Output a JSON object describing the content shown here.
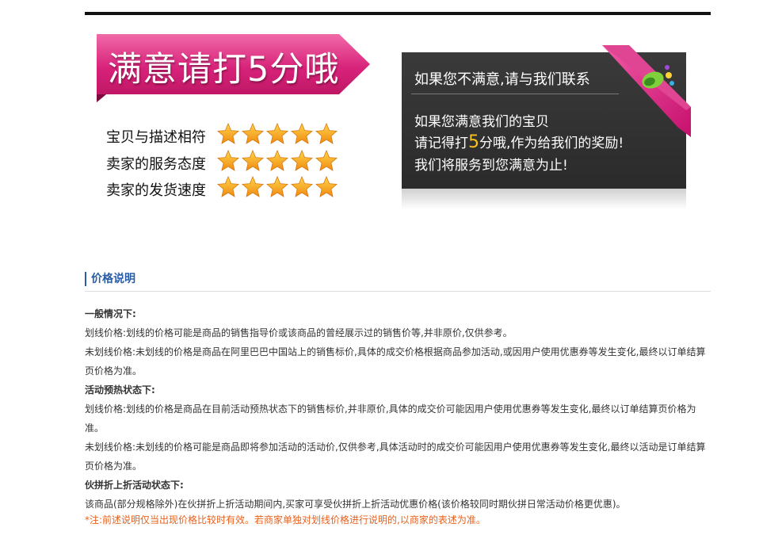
{
  "banner": {
    "title": "满意请打5分哦"
  },
  "ratings": [
    {
      "label": "宝贝与描述相符",
      "stars": 5
    },
    {
      "label": "卖家的服务态度",
      "stars": 5
    },
    {
      "label": "卖家的发货速度",
      "stars": 5
    }
  ],
  "panel": {
    "title": "如果您不满意,请与我们联系",
    "line1": "如果您满意我们的宝贝",
    "line2_pre": "请记得打",
    "line2_num": "5",
    "line2_post": "分哦,作为给我们的奖励!",
    "line3": "我们将服务到您满意为止!"
  },
  "colors": {
    "accent": "#2a5da8",
    "banner_pink": "#d8227a",
    "note_orange": "#e8611c",
    "star": "#f5a21c"
  },
  "price": {
    "title": "价格说明",
    "h1": "一般情况下:",
    "p1": "划线价格:划线的价格可能是商品的销售指导价或该商品的曾经展示过的销售价等,并非原价,仅供参考。",
    "p2": "未划线价格:未划线的价格是商品在阿里巴巴中国站上的销售标价,具体的成交价格根据商品参加活动,或因用户使用优惠券等发生变化,最终以订单结算页价格为准。",
    "h2": "活动预热状态下:",
    "p3": "划线价格:划线的价格是商品在目前活动预热状态下的销售标价,并非原价,具体的成交价可能因用户使用优惠券等发生变化,最终以订单结算页价格为准。",
    "p4": "未划线价格:未划线的价格可能是商品即将参加活动的活动价,仅供参考,具体活动时的成交价可能因用户使用优惠券等发生变化,最终以活动是订单结算页价格为准。",
    "h3": "伙拼折上折活动状态下:",
    "p5": "该商品(部分规格除外)在伙拼折上折活动期间内,买家可享受伙拼折上折活动优惠价格(该价格较同时期伙拼日常活动价格更优惠)。",
    "note": "*注:前述说明仅当出现价格比较时有效。若商家单独对划线价格进行说明的,以商家的表述为准。"
  }
}
